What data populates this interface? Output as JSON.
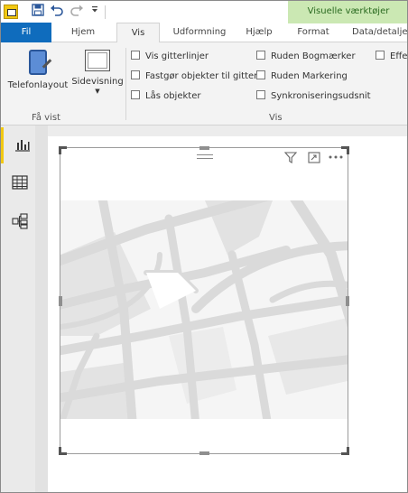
{
  "titlebar": {
    "context_label": "Visuelle værktøjer",
    "icons": [
      "powerbi-app-icon",
      "save-icon",
      "undo-icon",
      "redo-icon",
      "customize-dropdown-icon"
    ]
  },
  "tabs": {
    "fil": "Fil",
    "hjem": "Hjem",
    "vis": "Vis",
    "udformning": "Udformning",
    "hjaelp": "Hjælp",
    "format": "Format",
    "data": "Data/detaljer"
  },
  "ribbon": {
    "telefonlayout": "Telefonlayout",
    "sidevisning": "Sidevisning",
    "group_fa_vist": "Få vist",
    "group_vis": "Vis",
    "checkboxes": {
      "vis_gitterlinjer": "Vis gitterlinjer",
      "fastgor": "Fastgør objekter til gitter",
      "las_objekter": "Lås objekter",
      "ruden_bogmaerker": "Ruden Bogmærker",
      "ruden_markering": "Ruden Markering",
      "synkronisering": "Synkroniseringsudsnit",
      "effekt": "Effek"
    }
  },
  "sidebar": {
    "active": "report-view",
    "items": [
      "report-view-icon",
      "data-view-icon",
      "model-view-icon"
    ]
  },
  "colors": {
    "accent": "#0f6cbd",
    "context": "#cbe8b3",
    "active_marker": "#f2c811"
  }
}
